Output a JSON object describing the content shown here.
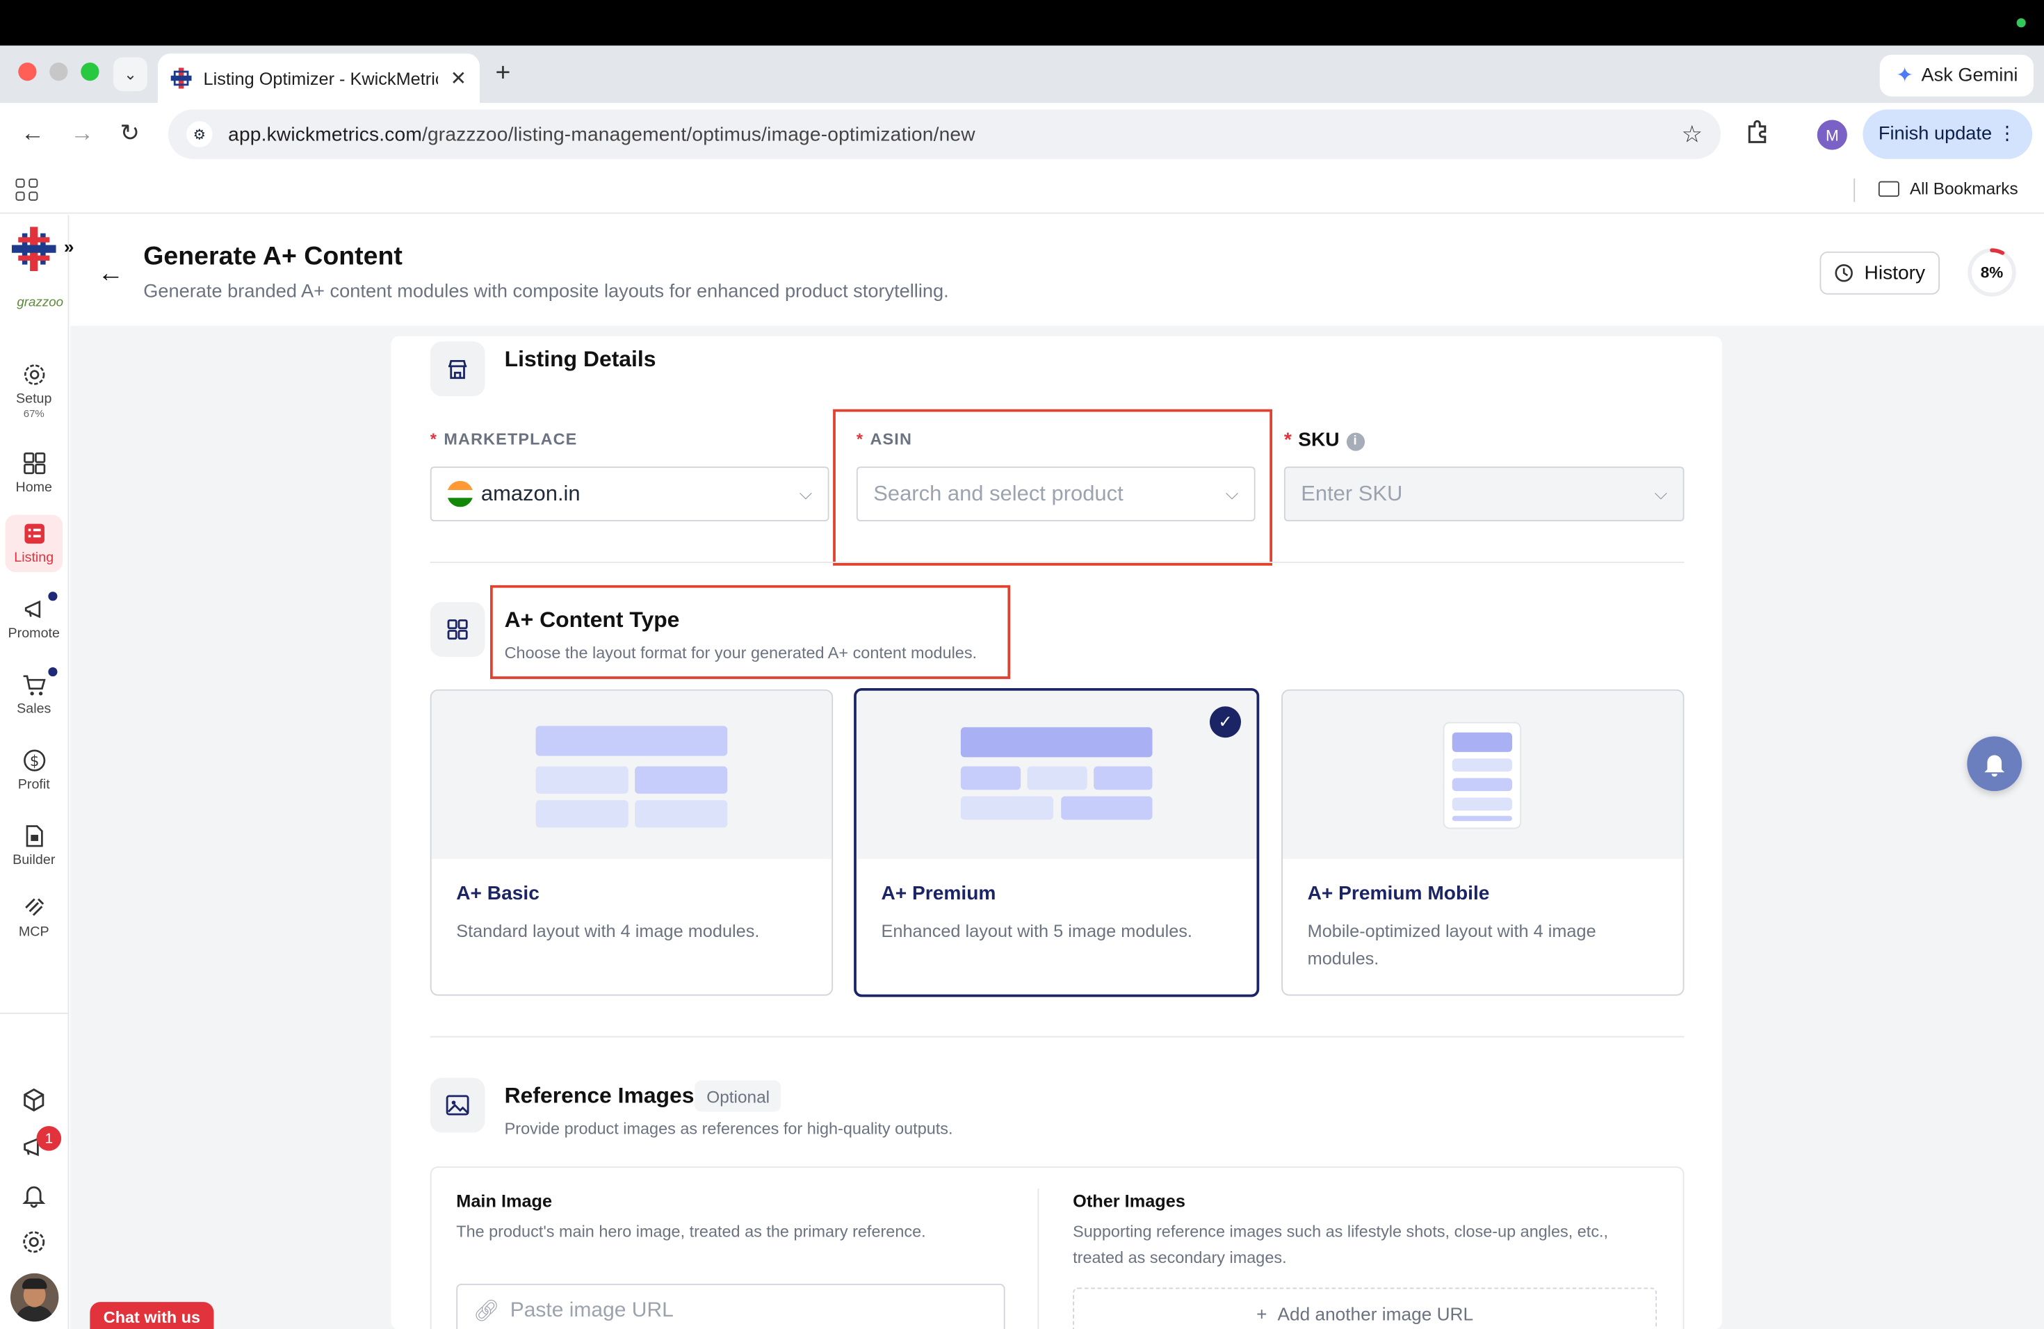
{
  "browser": {
    "tab_title": "Listing Optimizer - KwickMetrics",
    "url_domain": "app.kwickmetrics.com",
    "url_path": "/grazzzoo/listing-management/optimus/image-optimization/new",
    "ask_gemini": "Ask Gemini",
    "profile_initial": "M",
    "finish_update": "Finish update",
    "all_bookmarks": "All Bookmarks"
  },
  "sidebar": {
    "brand": "grazzoo",
    "items": [
      {
        "label": "Setup",
        "sub": "67%",
        "icon": "gear-icon"
      },
      {
        "label": "Home",
        "icon": "grid-icon"
      },
      {
        "label": "Listing",
        "icon": "listing-icon"
      },
      {
        "label": "Promote",
        "icon": "megaphone-icon"
      },
      {
        "label": "Sales",
        "icon": "cart-icon"
      },
      {
        "label": "Profit",
        "icon": "dollar-icon"
      },
      {
        "label": "Builder",
        "icon": "document-icon"
      },
      {
        "label": "MCP",
        "icon": "mcp-icon"
      }
    ],
    "notification_count": "1"
  },
  "header": {
    "title": "Generate A+ Content",
    "subtitle": "Generate branded A+ content modules with composite layouts for enhanced product storytelling.",
    "history": "History",
    "progress_label": "8%",
    "progress_value": 0.08
  },
  "listing_details": {
    "title": "Listing Details",
    "marketplace_label": "MARKETPLACE",
    "marketplace_value": "amazon.in",
    "asin_label": "ASIN",
    "asin_placeholder": "Search and select product",
    "sku_label": "SKU",
    "sku_placeholder": "Enter SKU"
  },
  "content_type": {
    "title": "A+ Content Type",
    "subtitle": "Choose the layout format for your generated A+ content modules.",
    "options": [
      {
        "name": "A+ Basic",
        "desc": "Standard layout with 4 image modules."
      },
      {
        "name": "A+ Premium",
        "desc": "Enhanced layout with 5 image modules.",
        "selected": true
      },
      {
        "name": "A+ Premium Mobile",
        "desc": "Mobile-optimized layout with 4 image modules."
      }
    ]
  },
  "reference_images": {
    "title": "Reference Images",
    "optional": "Optional",
    "subtitle": "Provide product images as references for high-quality outputs.",
    "main_label": "Main Image",
    "main_desc": "The product's main hero image, treated as the primary reference.",
    "main_placeholder": "Paste image URL",
    "other_label": "Other Images",
    "other_desc": "Supporting reference images such as lifestyle shots, close-up angles, etc., treated as secondary images.",
    "add_url": "Add another image URL"
  },
  "chat": "Chat with us",
  "colors": {
    "accent": "#e2333d",
    "navy": "#1b2464",
    "highlight": "#e1412f"
  }
}
